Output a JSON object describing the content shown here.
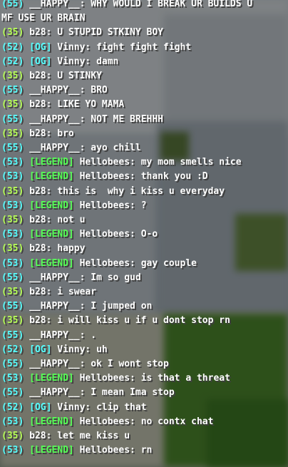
{
  "colors": {
    "level_green": "#b6ff55",
    "level_cyan": "#55ffff",
    "rank_og": "#55ffff",
    "rank_legend": "#55ff55",
    "message": "#ffffff"
  },
  "chat": {
    "lines": [
      {
        "level": "(55)",
        "rank": "",
        "name": "__HAPPY__:",
        "message": "WHY WOULD I BREAK UR BUILDS U"
      },
      {
        "level": "",
        "rank": "",
        "name": "",
        "message": "MF USE UR BRAIN"
      },
      {
        "level": "(35)",
        "rank": "",
        "name": "b28:",
        "message": "U STUPID STKINY BOY"
      },
      {
        "level": "(52)",
        "rank": "[OG]",
        "name": "Vinny:",
        "message": "fight fight fight"
      },
      {
        "level": "(52)",
        "rank": "[OG]",
        "name": "Vinny:",
        "message": "damn"
      },
      {
        "level": "(35)",
        "rank": "",
        "name": "b28:",
        "message": "U STINKY"
      },
      {
        "level": "(55)",
        "rank": "",
        "name": "__HAPPY__:",
        "message": "BRO"
      },
      {
        "level": "(35)",
        "rank": "",
        "name": "b28:",
        "message": "LIKE YO MAMA"
      },
      {
        "level": "(55)",
        "rank": "",
        "name": "__HAPPY__:",
        "message": "NOT ME BREHHH"
      },
      {
        "level": "(35)",
        "rank": "",
        "name": "b28:",
        "message": "bro"
      },
      {
        "level": "(55)",
        "rank": "",
        "name": "__HAPPY__:",
        "message": "ayo chill"
      },
      {
        "level": "(53)",
        "rank": "[LEGEND]",
        "name": "Hellobees:",
        "message": "my mom smells nice"
      },
      {
        "level": "(53)",
        "rank": "[LEGEND]",
        "name": "Hellobees:",
        "message": "thank you :D"
      },
      {
        "level": "(35)",
        "rank": "",
        "name": "b28:",
        "message": "this is  why i kiss u everyday"
      },
      {
        "level": "(53)",
        "rank": "[LEGEND]",
        "name": "Hellobees:",
        "message": "?"
      },
      {
        "level": "(35)",
        "rank": "",
        "name": "b28:",
        "message": "not u"
      },
      {
        "level": "(53)",
        "rank": "[LEGEND]",
        "name": "Hellobees:",
        "message": "O-o"
      },
      {
        "level": "(35)",
        "rank": "",
        "name": "b28:",
        "message": "happy"
      },
      {
        "level": "(53)",
        "rank": "[LEGEND]",
        "name": "Hellobees:",
        "message": "gay couple"
      },
      {
        "level": "(55)",
        "rank": "",
        "name": "__HAPPY__:",
        "message": "Im so gud"
      },
      {
        "level": "(35)",
        "rank": "",
        "name": "b28:",
        "message": "i swear"
      },
      {
        "level": "(55)",
        "rank": "",
        "name": "__HAPPY__:",
        "message": "I jumped on"
      },
      {
        "level": "(35)",
        "rank": "",
        "name": "b28:",
        "message": "i will kiss u if u dont stop rn"
      },
      {
        "level": "(55)",
        "rank": "",
        "name": "__HAPPY__:",
        "message": "."
      },
      {
        "level": "(52)",
        "rank": "[OG]",
        "name": "Vinny:",
        "message": "uh"
      },
      {
        "level": "(55)",
        "rank": "",
        "name": "__HAPPY__:",
        "message": "ok I wont stop"
      },
      {
        "level": "(53)",
        "rank": "[LEGEND]",
        "name": "Hellobees:",
        "message": "is that a threat"
      },
      {
        "level": "(55)",
        "rank": "",
        "name": "__HAPPY__:",
        "message": "I mean Ima stop"
      },
      {
        "level": "(52)",
        "rank": "[OG]",
        "name": "Vinny:",
        "message": "clip that"
      },
      {
        "level": "(53)",
        "rank": "[LEGEND]",
        "name": "Hellobees:",
        "message": "no contx chat"
      },
      {
        "level": "(35)",
        "rank": "",
        "name": "b28:",
        "message": "let me kiss u"
      },
      {
        "level": "(53)",
        "rank": "[LEGEND]",
        "name": "Hellobees:",
        "message": "rn"
      }
    ]
  }
}
